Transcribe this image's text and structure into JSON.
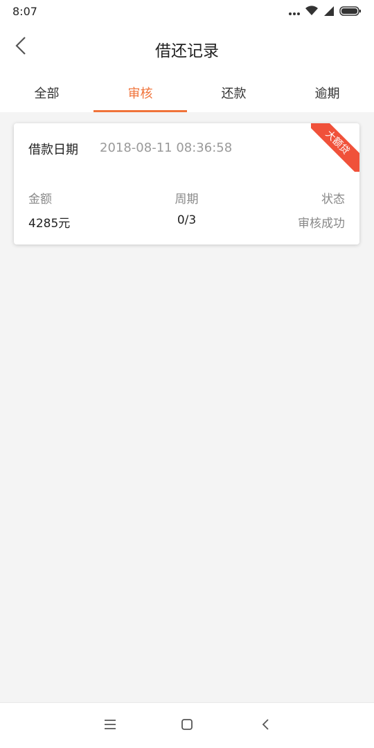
{
  "status_bar": {
    "time": "8:07"
  },
  "header": {
    "title": "借还记录"
  },
  "tabs": [
    {
      "label": "全部"
    },
    {
      "label": "审核"
    },
    {
      "label": "还款"
    },
    {
      "label": "逾期"
    }
  ],
  "active_tab": "审核",
  "record": {
    "date_label": "借款日期",
    "date_value": "2018-08-11 08:36:58",
    "ribbon": "大额贷",
    "amount_label": "金额",
    "amount_value": "4285元",
    "period_label": "周期",
    "period_value": "0/3",
    "status_label": "状态",
    "status_value": "审核成功"
  },
  "colors": {
    "accent": "#f0733a",
    "ribbon": "#f0513a",
    "background": "#f4f4f4"
  },
  "icons": [
    "wifi-icon",
    "signal-icon",
    "battery-icon",
    "back-icon",
    "menu-icon",
    "home-icon",
    "nav-back-icon"
  ]
}
